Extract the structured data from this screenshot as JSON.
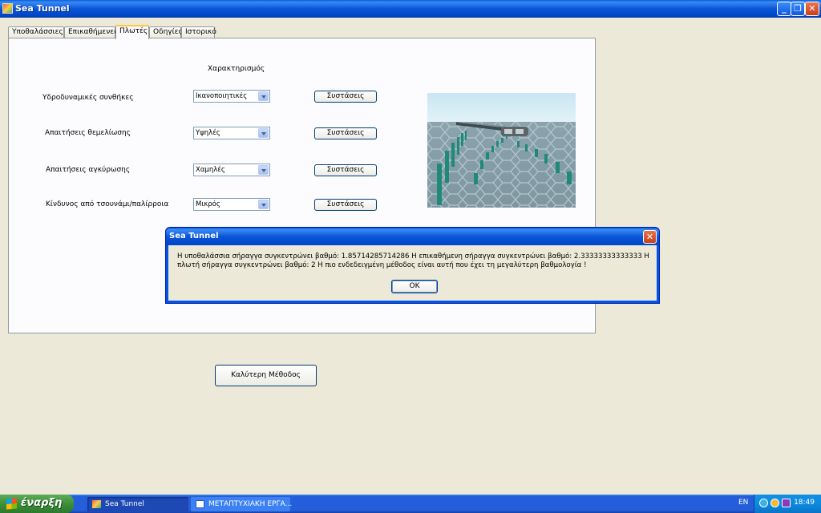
{
  "window": {
    "title": "Sea Tunnel",
    "minimize_glyph": "_",
    "maximize_glyph": "❐",
    "close_glyph": "✕"
  },
  "tabs": [
    {
      "label": "Υποθαλάσσιες"
    },
    {
      "label": "Επικαθήμενες"
    },
    {
      "label": "Πλωτές",
      "active": true
    },
    {
      "label": "Οδηγίες"
    },
    {
      "label": "Ιστορικό"
    }
  ],
  "panel": {
    "column_header": "Χαρακτηρισμός",
    "rows": [
      {
        "label": "Υδροδυναμικές συνθήκες",
        "value": "Ικανοποιητικές",
        "button": "Συστάσεις"
      },
      {
        "label": "Απαιτήσεις θεμελίωσης",
        "value": "Υψηλές",
        "button": "Συστάσεις"
      },
      {
        "label": "Απαιτήσεις αγκύρωσης",
        "value": "Χαμηλές",
        "button": "Συστάσεις"
      },
      {
        "label": "Κίνδυνος από τσουνάμι/παλίρροια",
        "value": "Μικρός",
        "button": "Συστάσεις"
      }
    ]
  },
  "best_method_button": "Καλύτερη Μέθοδος",
  "dialog": {
    "title": "Sea Tunnel",
    "message": "Η υποθαλάσσια σήραγγα συγκεντρώνει βαθμό: 1.85714285714286  Η επικαθήμενη σήραγγα συγκεντρώνει βαθμό: 2.33333333333333  Η πλωτή σήραγγα συγκεντρώνει βαθμό: 2   Η πιο ενδεδειγμένη μέθοδος είναι αυτή που έχει τη μεγαλύτερη βαθμολογία !",
    "ok": "OK"
  },
  "taskbar": {
    "start": "έναρξη",
    "tasks": [
      {
        "label": "Sea Tunnel",
        "active": true
      },
      {
        "label": "ΜΕΤΑΠΤΥΧΙΑΚΗ ΕΡΓΑ..."
      }
    ],
    "language": "EN",
    "clock": "18:49"
  }
}
